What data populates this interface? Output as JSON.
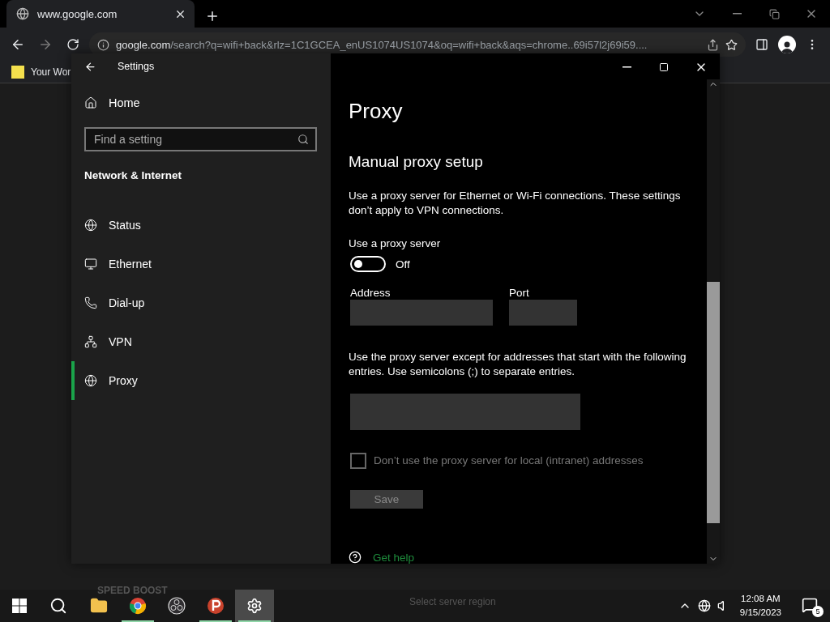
{
  "browser": {
    "tab": {
      "title": "www.google.com"
    },
    "address": {
      "host": "google.com",
      "path": "/search?q=wifi+back&rlz=1C1GCEA_enUS1074US1074&oq=wifi+back&aqs=chrome..69i57l2j69i59...."
    },
    "bookmarks": [
      {
        "label": "Your Wor"
      }
    ]
  },
  "settings_window": {
    "title": "Settings",
    "sidebar": {
      "home": "Home",
      "search": {
        "placeholder": "Find a setting"
      },
      "section": "Network & Internet",
      "items": [
        {
          "kind": "status",
          "label": "Status",
          "selected": false
        },
        {
          "kind": "ethernet",
          "label": "Ethernet",
          "selected": false
        },
        {
          "kind": "dialup",
          "label": "Dial-up",
          "selected": false
        },
        {
          "kind": "vpn",
          "label": "VPN",
          "selected": false
        },
        {
          "kind": "proxy",
          "label": "Proxy",
          "selected": true
        }
      ]
    },
    "content": {
      "page_title": "Proxy",
      "section_title": "Manual proxy setup",
      "description": "Use a proxy server for Ethernet or Wi-Fi connections. These settings don’t apply to VPN connections.",
      "toggle": {
        "label": "Use a proxy server",
        "on": false,
        "state_text": "Off"
      },
      "address": {
        "label": "Address"
      },
      "port": {
        "label": "Port"
      },
      "exceptions_description": "Use the proxy server except for addresses that start with the following entries. Use semicolons (;) to separate entries.",
      "local_checkbox": {
        "label": "Don’t use the proxy server for local (intranet) addresses",
        "checked": false,
        "disabled": true
      },
      "save_button": {
        "label": "Save",
        "disabled": true
      },
      "help_link": "Get help"
    }
  },
  "taskbar": {
    "background_texts": [
      "SPEED BOOST",
      "Select server region"
    ],
    "apps": [
      {
        "kind": "explorer",
        "running": false,
        "selected": false
      },
      {
        "kind": "chrome",
        "running": true,
        "selected": false
      },
      {
        "kind": "obs",
        "running": false,
        "selected": false
      },
      {
        "kind": "psiphon",
        "running": true,
        "selected": false
      },
      {
        "kind": "settings",
        "running": true,
        "selected": true
      }
    ],
    "clock": {
      "time": "12:08 AM",
      "date": "9/15/2023"
    },
    "notifications": "5"
  }
}
